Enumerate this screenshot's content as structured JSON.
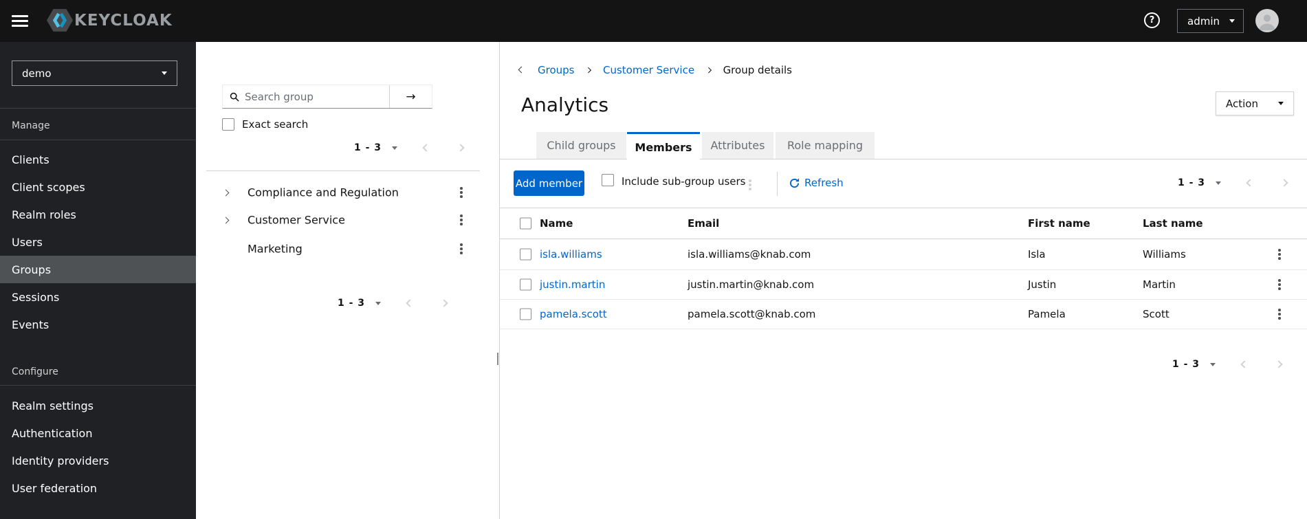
{
  "colors": {
    "accent": "#0066cc",
    "masthead_bg": "#141414",
    "sidebar_bg": "#1f2124",
    "active_nav_bg": "#4f5255",
    "tab_inactive_bg": "#f0f0f0",
    "border": "#d2d2d2",
    "muted_text": "#6a6e73"
  },
  "icons": {
    "menu": "hamburger-icon",
    "brand": "keycloak-hexagon-icon",
    "help": "question-circle-icon",
    "avatar": "user-avatar-icon",
    "search": "magnifier-icon",
    "search_submit": "arrow-right-icon",
    "caret": "caret-down-icon",
    "kebab": "vertical-ellipsis-icon",
    "refresh": "sync-icon",
    "prev": "angle-left-icon",
    "next": "angle-right-icon",
    "expand": "angle-right-icon"
  },
  "masthead": {
    "brand": "KEYCLOAK",
    "user_menu_label": "admin"
  },
  "sidebar": {
    "realm_selected": "demo",
    "sections": [
      {
        "label": "Manage",
        "items": [
          "Clients",
          "Client scopes",
          "Realm roles",
          "Users",
          "Groups",
          "Sessions",
          "Events"
        ],
        "active_item": "Groups"
      },
      {
        "label": "Configure",
        "items": [
          "Realm settings",
          "Authentication",
          "Identity providers",
          "User federation"
        ]
      }
    ]
  },
  "groups_panel": {
    "search_placeholder": "Search group",
    "exact_search_label": "Exact search",
    "pagination_range": "1 - 3",
    "tree": [
      {
        "label": "Compliance and Regulation",
        "expandable": true
      },
      {
        "label": "Customer Service",
        "expandable": true
      },
      {
        "label": "Marketing",
        "expandable": false
      }
    ]
  },
  "main": {
    "breadcrumb": [
      "Groups",
      "Customer Service",
      "Group details"
    ],
    "title": "Analytics",
    "action_label": "Action",
    "tabs": [
      {
        "label": "Child groups",
        "active": false
      },
      {
        "label": "Members",
        "active": true
      },
      {
        "label": "Attributes",
        "active": false
      },
      {
        "label": "Role mapping",
        "active": false
      }
    ],
    "toolbar": {
      "add_member_label": "Add member",
      "include_subgroups_label": "Include sub-group users",
      "refresh_label": "Refresh",
      "pagination_range": "1 - 3"
    },
    "table": {
      "columns": [
        "Name",
        "Email",
        "First name",
        "Last name"
      ],
      "rows": [
        {
          "name": "isla.williams",
          "email": "isla.williams@knab.com",
          "first": "Isla",
          "last": "Williams"
        },
        {
          "name": "justin.martin",
          "email": "justin.martin@knab.com",
          "first": "Justin",
          "last": "Martin"
        },
        {
          "name": "pamela.scott",
          "email": "pamela.scott@knab.com",
          "first": "Pamela",
          "last": "Scott"
        }
      ]
    },
    "bottom_pagination_range": "1 - 3"
  }
}
